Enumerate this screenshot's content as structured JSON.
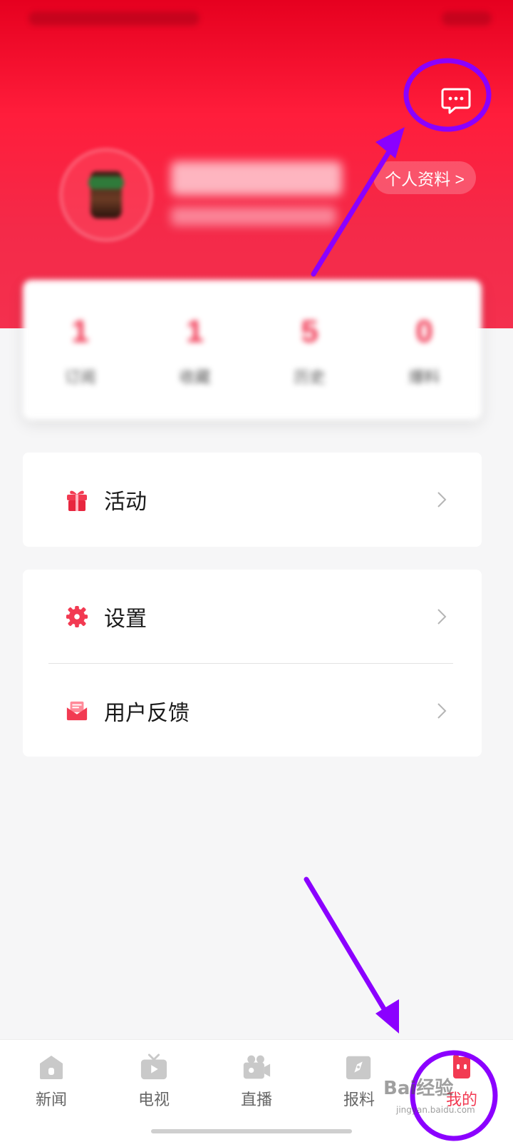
{
  "header": {
    "profile_button_label": "个人资料 >"
  },
  "stats": [
    {
      "value": "1",
      "label": "订阅"
    },
    {
      "value": "1",
      "label": "收藏"
    },
    {
      "value": "5",
      "label": "历史"
    },
    {
      "value": "0",
      "label": "爆料"
    }
  ],
  "menu": {
    "group1": [
      {
        "label": "活动",
        "icon": "gift-icon"
      }
    ],
    "group2": [
      {
        "label": "设置",
        "icon": "gear-icon"
      },
      {
        "label": "用户反馈",
        "icon": "envelope-icon"
      }
    ]
  },
  "bottom_nav": {
    "items": [
      {
        "label": "新闻",
        "icon": "news-icon"
      },
      {
        "label": "电视",
        "icon": "tv-icon"
      },
      {
        "label": "直播",
        "icon": "camera-icon"
      },
      {
        "label": "报料",
        "icon": "compass-icon"
      },
      {
        "label": "我的",
        "icon": "mine-icon",
        "active": true
      }
    ]
  },
  "watermark": {
    "text": "Bai经验",
    "sub": "jingyan.baidu.com"
  },
  "colors": {
    "brand_red": "#f0334f",
    "annotation_purple": "#8b00ff",
    "text_primary": "#1a1a1a"
  }
}
